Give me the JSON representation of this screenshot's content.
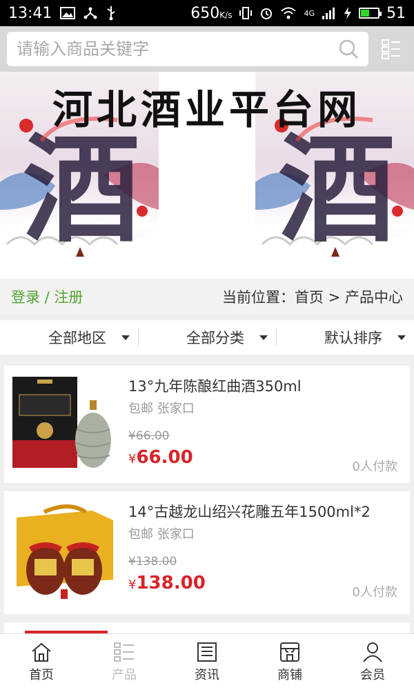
{
  "status_bar": {
    "time": "13:41",
    "speed": "650",
    "speed_unit": "K/s",
    "network": "4G",
    "battery": "51",
    "battery_level": 0.51,
    "left_icons": [
      "image-icon",
      "share-icon",
      "usb-icon"
    ],
    "right_icons": [
      "vibrate-icon",
      "alarm-icon",
      "wifi-icon",
      "signal-icon",
      "charging-icon",
      "battery-icon"
    ]
  },
  "search": {
    "placeholder": "请输入商品关键字"
  },
  "banner": {
    "title": "河北酒业平台网",
    "character": "酒"
  },
  "location": {
    "login_register": "登录 / 注册",
    "breadcrumb": "当前位置：首页 > 产品中心"
  },
  "filters": [
    {
      "label": "全部地区"
    },
    {
      "label": "全部分类"
    },
    {
      "label": "默认排序"
    }
  ],
  "products": [
    {
      "name": "13°九年陈酿红曲酒350ml",
      "shipping": "包邮 张家口",
      "original_price": "¥66.00",
      "currency": "¥",
      "price": "66.00",
      "paid": "0人付款"
    },
    {
      "name": "14°古越龙山绍兴花雕五年1500ml*2",
      "shipping": "包邮 张家口",
      "original_price": "¥138.00",
      "currency": "¥",
      "price": "138.00",
      "paid": "0人付款"
    }
  ],
  "bottom_nav": [
    {
      "label": "首页",
      "icon": "home-icon"
    },
    {
      "label": "产品",
      "icon": "grid-list-icon"
    },
    {
      "label": "资讯",
      "icon": "news-icon"
    },
    {
      "label": "商铺",
      "icon": "shop-icon"
    },
    {
      "label": "会员",
      "icon": "user-icon"
    }
  ],
  "colors": {
    "accent_green": "#52a52e",
    "price_red": "#d8232a",
    "status_bar": "#000000"
  }
}
